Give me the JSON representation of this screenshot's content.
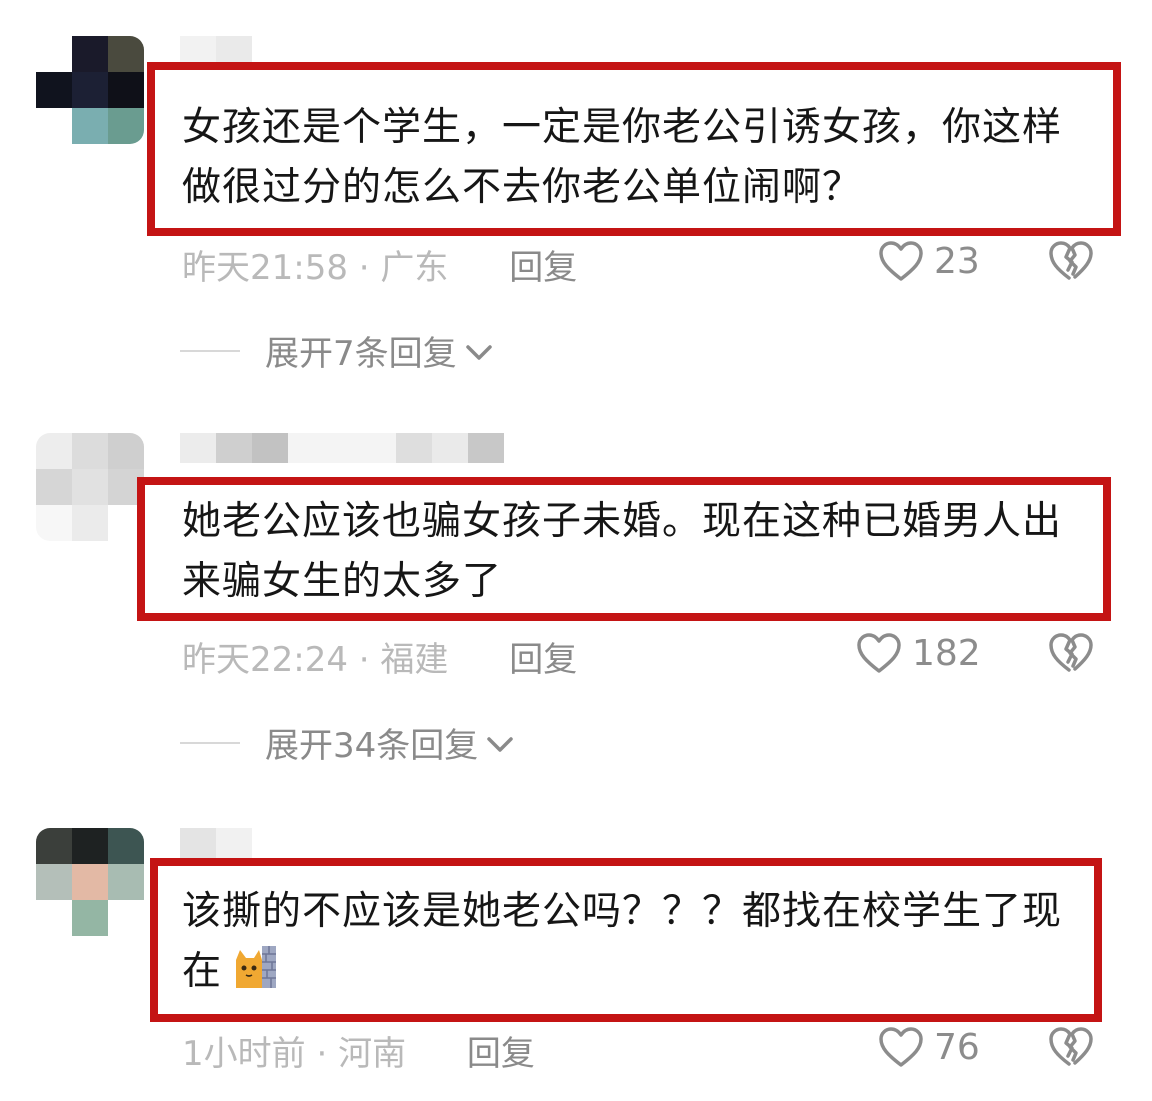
{
  "comments": [
    {
      "text": "女孩还是个学生，一定是你老公引诱女孩，你这样做很过分的怎么不去你老公单位闹啊？",
      "time": "昨天21:58",
      "location": "广东",
      "reply_label": "回复",
      "likes": "23",
      "expand_label": "展开7条回复"
    },
    {
      "text": "她老公应该也骗女孩子未婚。现在这种已婚男人出来骗女生的太多了",
      "time": "昨天22:24",
      "location": "福建",
      "reply_label": "回复",
      "likes": "182",
      "expand_label": "展开34条回复"
    },
    {
      "text": "该撕的不应该是她老公吗？？？都找在校学生了现在",
      "time": "1小时前",
      "location": "河南",
      "reply_label": "回复",
      "likes": "76"
    }
  ],
  "separator": " · ",
  "icons": {
    "like": "heart-outline-icon",
    "dislike": "broken-heart-icon",
    "expand": "chevron-down-icon",
    "emoji": "cat-wall-emoji"
  },
  "colors": {
    "highlight_border": "#c41414",
    "meta_text": "#b9b9b9",
    "body_text": "#161616"
  }
}
